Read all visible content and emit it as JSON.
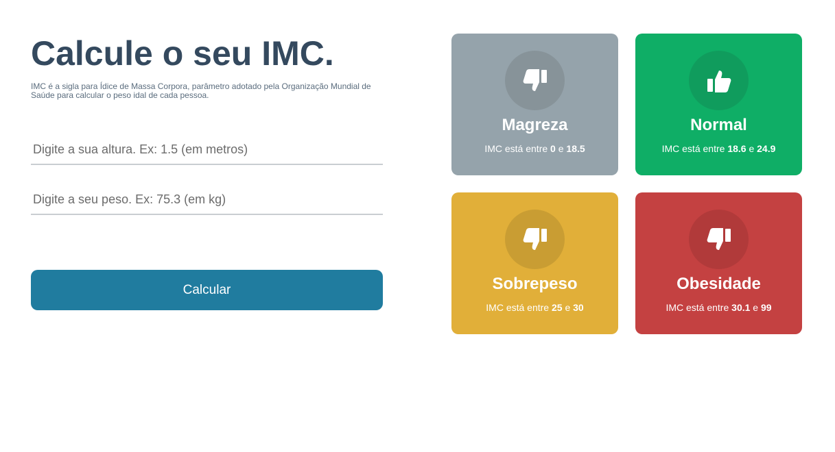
{
  "header": {
    "title": "Calcule o seu IMC.",
    "subtitle": "IMC é a sigla para Ídice de Massa Corpora, parâmetro adotado pela Organização Mundial de Saúde para calcular o peso idal de cada pessoa."
  },
  "form": {
    "height_placeholder": "Digite a sua altura. Ex: 1.5 (em metros)",
    "height_value": "",
    "weight_placeholder": "Digite a seu peso. Ex: 75.3 (em kg)",
    "weight_value": "",
    "calculate_label": "Calcular"
  },
  "cards": {
    "magreza": {
      "name": "Magreza",
      "prefix": "IMC está entre",
      "min": "0",
      "joiner": "e",
      "max": "18.5",
      "icon": "thumbs-down-icon",
      "color": "#95a3ab"
    },
    "normal": {
      "name": "Normal",
      "prefix": "IMC está entre",
      "min": "18.6",
      "joiner": "e",
      "max": "24.9",
      "icon": "thumbs-up-icon",
      "color": "#0fae66"
    },
    "sobrepeso": {
      "name": "Sobrepeso",
      "prefix": "IMC está entre",
      "min": "25",
      "joiner": "e",
      "max": "30",
      "icon": "thumbs-down-icon",
      "color": "#e1af39"
    },
    "obesidade": {
      "name": "Obesidade",
      "prefix": "IMC está entre",
      "min": "30.1",
      "joiner": "e",
      "max": "99",
      "icon": "thumbs-down-icon",
      "color": "#c44141"
    }
  },
  "colors": {
    "title": "#34495e",
    "button": "#207c9f"
  }
}
